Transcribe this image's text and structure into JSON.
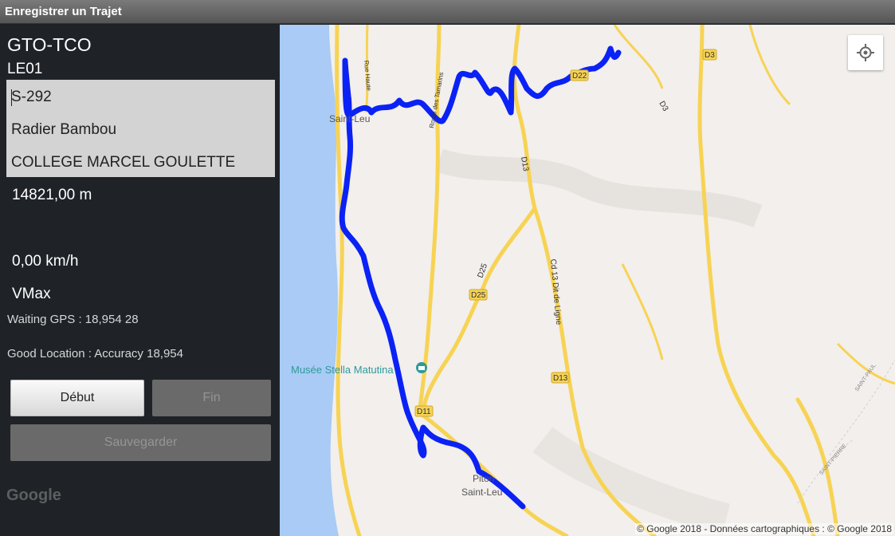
{
  "window": {
    "title": "Enregistrer un Trajet"
  },
  "panel": {
    "line_code": "GTO-TCO",
    "vehicle_code": "LE01",
    "stops": [
      "S-292",
      "Radier Bambou",
      "COLLEGE MARCEL GOULETTE"
    ],
    "distance": "14821,00 m",
    "speed": "0,00 km/h",
    "vmax": "VMax",
    "gps_status": "Waiting GPS : 18,954 28",
    "location_status": "Good Location : Accuracy 18,954",
    "buttons": {
      "start": "Début",
      "end": "Fin",
      "save": "Sauvegarder"
    }
  },
  "map": {
    "route_color": "#0b22f5",
    "road_color": "#f7d354",
    "water_color": "#a9cbf5",
    "labels": {
      "d22": "D22",
      "d3": "D3",
      "d3b": "D3",
      "d13": "D13",
      "d13b": "D13",
      "d25": "D25",
      "d25b": "D25",
      "d11": "D11",
      "cd13": "Cd 13 Dit de Ligne",
      "saint_leu_north": "Saint-Leu",
      "museum": "Musée Stella Matutina",
      "piton": "Piton",
      "saint_leu_south": "Saint-Leu",
      "rue_haute": "Rue Haute",
      "tamarins": "Route des Tamarins",
      "saint_paul": "SAINT-PAUL",
      "saint_pierre": "SAINT-PIERRE"
    },
    "locate_icon": "crosshair-locate-icon",
    "google_logo": "Google",
    "attribution": "© Google 2018 - Données cartographiques : © Google 2018"
  }
}
